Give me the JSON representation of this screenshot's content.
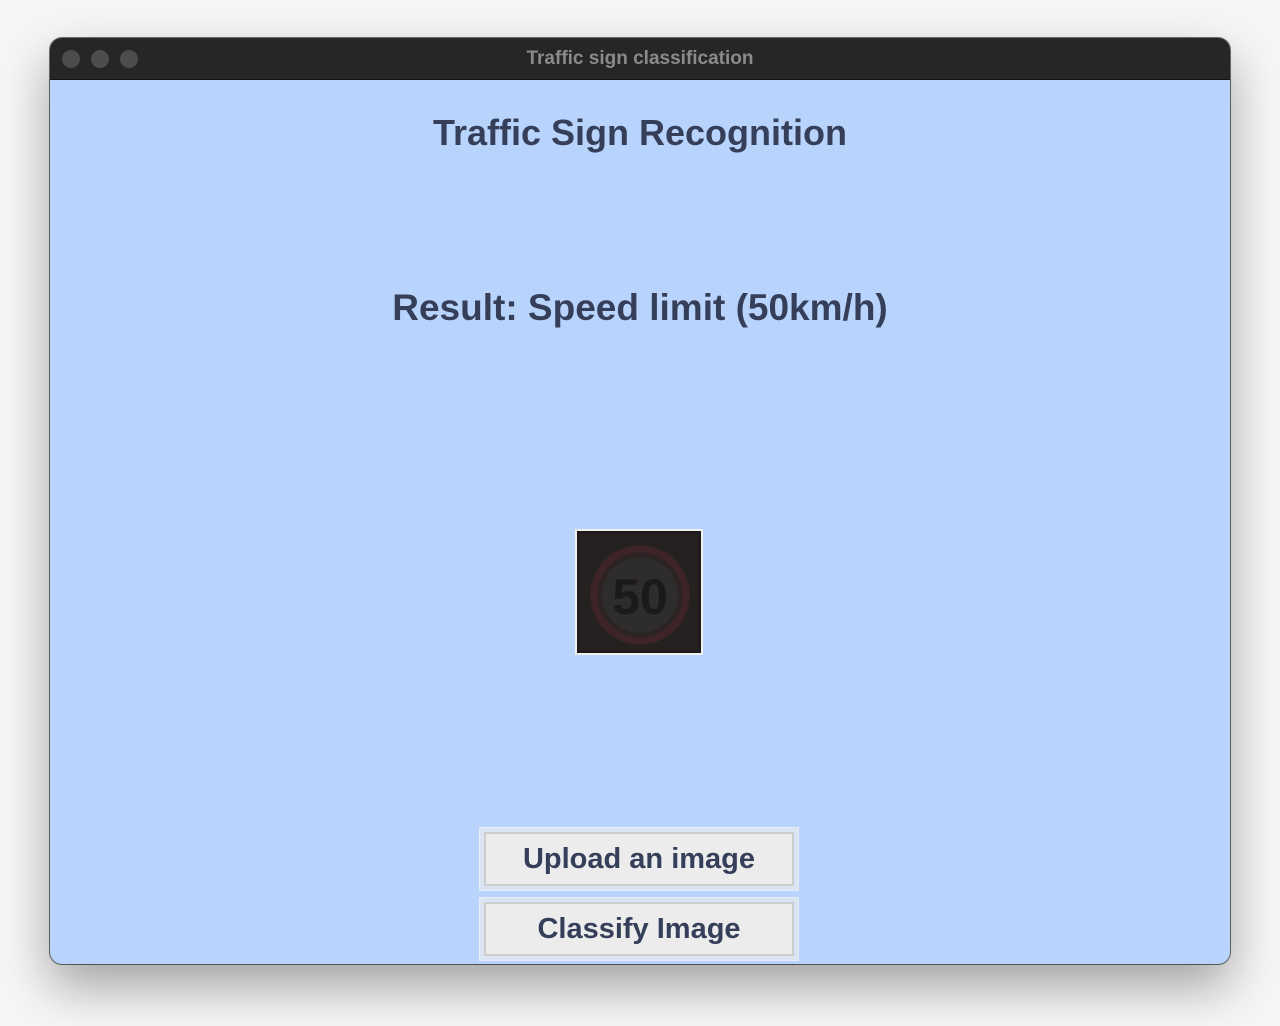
{
  "window": {
    "title": "Traffic sign classification"
  },
  "app": {
    "heading": "Traffic Sign Recognition",
    "result": "Result: Speed limit (50km/h)",
    "preview_sign_number": "50"
  },
  "buttons": {
    "upload": "Upload an image",
    "classify": "Classify Image"
  },
  "colors": {
    "background": "#b8d4fc",
    "text": "#363f5a",
    "titlebar": "#262626",
    "button": "#ececec"
  },
  "icons": {
    "preview": "speed-limit-sign-image"
  }
}
